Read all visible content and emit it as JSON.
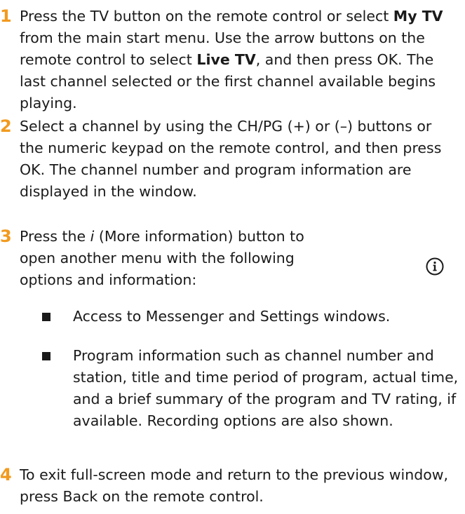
{
  "colors": {
    "text": "#1a1a1a",
    "step_number": "#f29a1e",
    "bullet": "#1a1a1a"
  },
  "steps": [
    {
      "number": "1",
      "parts": [
        {
          "text": "Press the TV button on the remote control or select ",
          "style": "normal"
        },
        {
          "text": "My TV",
          "style": "bold"
        },
        {
          "text": " from the main start menu. Use the arrow buttons on the remote control to select ",
          "style": "normal"
        },
        {
          "text": "Live TV",
          "style": "bold"
        },
        {
          "text": ", and then press OK. The last channel selected or the first channel available begins playing.",
          "style": "normal"
        }
      ]
    },
    {
      "number": "2",
      "parts": [
        {
          "text": "Select a channel by using the CH/PG (+) or (–) buttons or the numeric keypad on the remote control, and then press OK. The channel number and program information are displayed in the window.",
          "style": "normal"
        }
      ]
    },
    {
      "number": "3",
      "parts": [
        {
          "text": "Press the ",
          "style": "normal"
        },
        {
          "text": "i",
          "style": "italic"
        },
        {
          "text": " (More information) button to open another menu with the following options and information:",
          "style": "normal"
        }
      ]
    },
    {
      "number": "4",
      "parts": [
        {
          "text": "To exit full-screen mode and return to the previous window, press Back on the remote control.",
          "style": "normal"
        }
      ]
    }
  ],
  "bullets": [
    "Access to Messenger and Settings windows.",
    "Program information such as channel number and station, title and time period of program, actual time, and a brief summary of the program and TV rating, if available. Recording options are also shown."
  ],
  "icons": {
    "info": "info-icon"
  }
}
